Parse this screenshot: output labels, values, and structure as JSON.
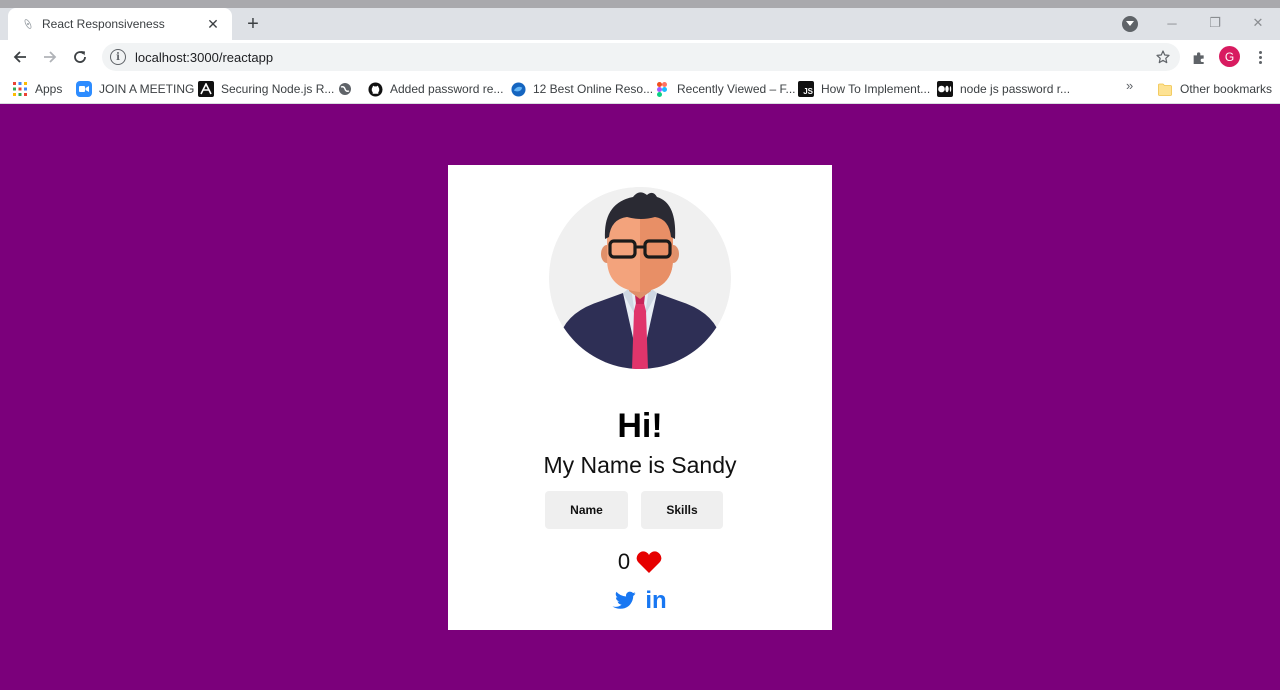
{
  "browser": {
    "tab_title": "React Responsiveness",
    "url": "localhost:3000/reactapp",
    "profile_initial": "G",
    "bookmarks": [
      {
        "label": "Apps",
        "icon": "apps-grid-icon"
      },
      {
        "label": "JOIN A MEETING",
        "icon": "zoom-icon"
      },
      {
        "label": "Securing Node.js R...",
        "icon": "auth0-icon"
      },
      {
        "label": "",
        "icon": "globe-icon"
      },
      {
        "label": "Added password re...",
        "icon": "github-icon"
      },
      {
        "label": "12 Best Online Reso...",
        "icon": "blue-globe-icon"
      },
      {
        "label": "Recently Viewed – F...",
        "icon": "figma-icon"
      },
      {
        "label": "How To Implement...",
        "icon": "js-icon"
      },
      {
        "label": "node js password r...",
        "icon": "medium-icon"
      }
    ],
    "other_bookmarks": "Other bookmarks",
    "more_chevron": "»"
  },
  "card": {
    "greeting": "Hi!",
    "intro": "My Name is Sandy",
    "name_button": "Name",
    "skills_button": "Skills",
    "like_count": "0"
  },
  "colors": {
    "page_background": "#7b007b",
    "card_background": "#ffffff",
    "heart": "#e60000",
    "social": "#1877f2",
    "button_background": "#efefef"
  }
}
